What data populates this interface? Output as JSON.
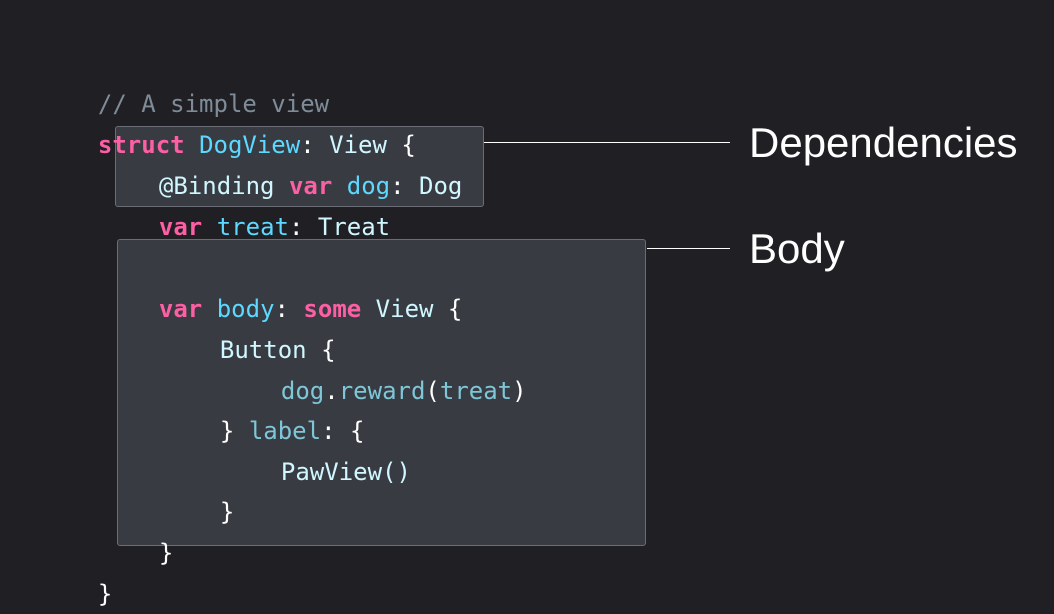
{
  "colors": {
    "background": "#1f1f24",
    "box_fill": "#393b42",
    "box_border": "#6a6d75",
    "keyword": "#fc5fa3",
    "type_name": "#d0f7ff",
    "declared_type": "#5dd8ff",
    "property": "#7dc7d8",
    "plain": "#ffffff",
    "comment": "#7f8c98"
  },
  "code": {
    "comment": "// A simple view",
    "struct_kw": "struct",
    "struct_name": "DogView",
    "struct_colon": ":",
    "struct_conformance": "View",
    "struct_open": "{",
    "dep1_attr": "@Binding",
    "dep1_var": "var",
    "dep1_name": "dog",
    "dep1_colon": ":",
    "dep1_type": "Dog",
    "dep2_var": "var",
    "dep2_name": "treat",
    "dep2_colon": ":",
    "dep2_type": "Treat",
    "body_var": "var",
    "body_name": "body",
    "body_colon": ":",
    "body_some": "some",
    "body_type": "View",
    "body_open": "{",
    "button_name": "Button",
    "button_open": "{",
    "call_receiver": "dog",
    "call_dot": ".",
    "call_method": "reward",
    "call_open_paren": "(",
    "call_arg": "treat",
    "call_close_paren": ")",
    "label_close_brace": "}",
    "label_kw": "label",
    "label_colon": ":",
    "label_open": "{",
    "pawview_call": "PawView()",
    "label_end": "}",
    "body_end": "}",
    "struct_end": "}"
  },
  "annotations": {
    "dependencies": "Dependencies",
    "body": "Body"
  }
}
